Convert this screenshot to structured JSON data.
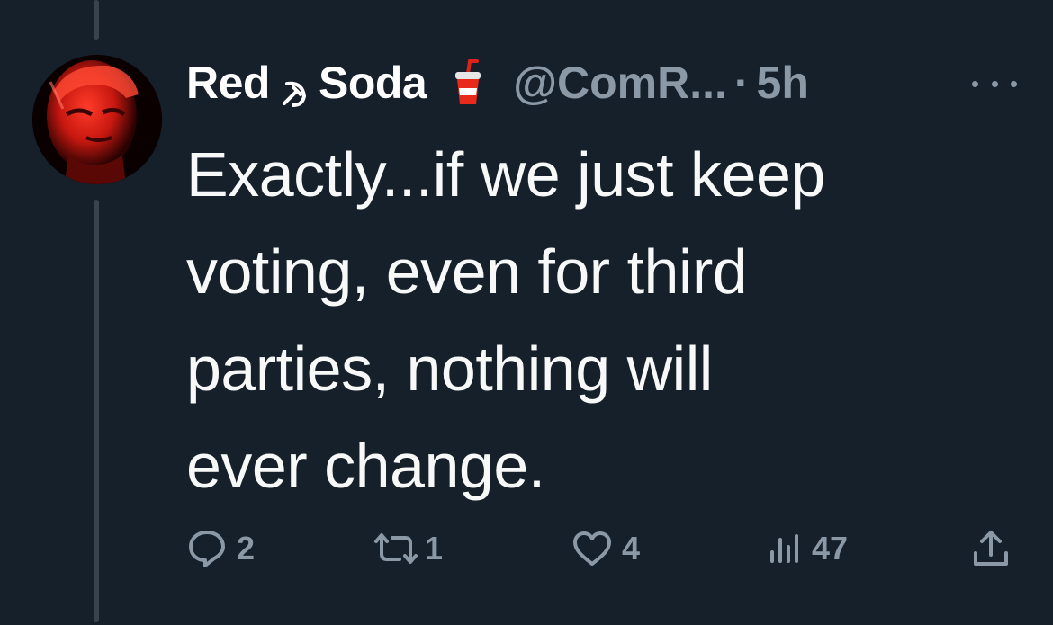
{
  "tweet": {
    "display_name_part1": "Red",
    "display_name_part2": "Soda",
    "name_emoji_1": "hammer-and-sickle-icon",
    "name_emoji_2": "soda-cup-icon",
    "handle": "@ComR...",
    "separator": "·",
    "time": "5h",
    "text_lines": [
      "Exactly...if we just keep",
      "voting, even for third",
      "parties, nothing will",
      "ever change."
    ]
  },
  "actions": {
    "replies": "2",
    "retweets": "1",
    "likes": "4",
    "views": "47"
  },
  "colors": {
    "background": "#15202b",
    "text": "#f7f9f9",
    "secondary": "#8b98a5",
    "thread_line": "#38444d",
    "avatar_accent": "#e0201a"
  }
}
